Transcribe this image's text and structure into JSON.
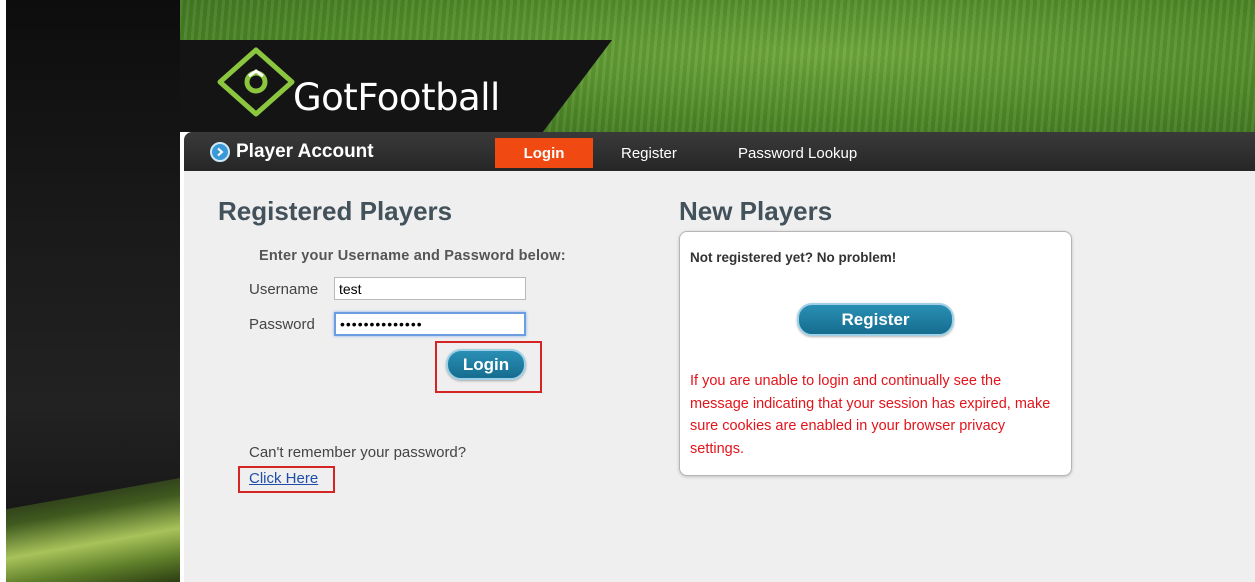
{
  "brand": {
    "name_part1": "Got",
    "name_part2": "Football",
    "accent_color": "#f04a12",
    "button_color": "#1d7fa3"
  },
  "nav": {
    "title": "Player Account",
    "title_icon": "chevron-right-circle-icon",
    "tabs": [
      {
        "label": "Login",
        "active": true
      },
      {
        "label": "Register",
        "active": false
      },
      {
        "label": "Password Lookup",
        "active": false
      }
    ]
  },
  "registered": {
    "heading": "Registered Players",
    "instructions": "Enter your Username and Password below:",
    "username_label": "Username",
    "username_value": "test",
    "password_label": "Password",
    "password_value": "••••••••••••••",
    "login_button": "Login",
    "forgot_text": "Can't remember your password?",
    "forgot_link": "Click Here"
  },
  "new_players": {
    "heading": "New Players",
    "lead": "Not registered yet? No problem!",
    "register_button": "Register",
    "warning": "If you are unable to login and continually see the message indicating that your session has expired, make sure cookies are enabled in your browser privacy settings.",
    "warning_color": "#e3141b"
  }
}
